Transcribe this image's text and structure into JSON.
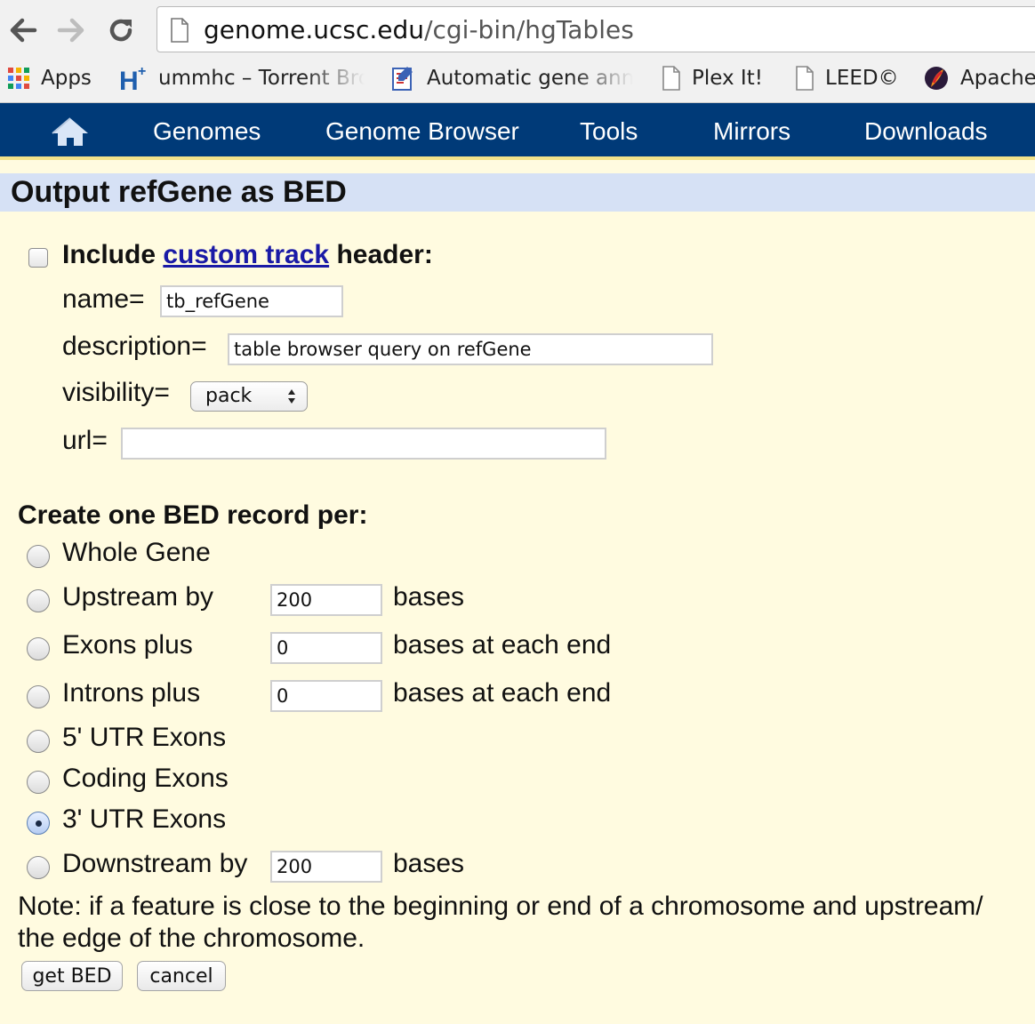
{
  "browser": {
    "url_host": "genome.ucsc.edu",
    "url_path": "/cgi-bin/hgTables",
    "bookmarks": [
      {
        "label": "Apps",
        "icon": "apps-grid-icon"
      },
      {
        "label": "ummhc – Torrent Bro",
        "icon": "h-plus-icon"
      },
      {
        "label": "Automatic gene anno",
        "icon": "document-edit-icon"
      },
      {
        "label": "Plex It!",
        "icon": "page-icon"
      },
      {
        "label": "LEED©",
        "icon": "page-icon"
      },
      {
        "label": "Apache",
        "icon": "apache-feather-icon"
      }
    ]
  },
  "sitenav": {
    "home_icon": "home-icon",
    "items": [
      "Genomes",
      "Genome Browser",
      "Tools",
      "Mirrors",
      "Downloads"
    ],
    "color": "#003a78"
  },
  "page": {
    "title": "Output refGene as BED"
  },
  "header_section": {
    "include_prefix": "Include",
    "include_link": "custom track",
    "include_suffix": "header:",
    "include_checked": false,
    "name_label": "name=",
    "name_value": "tb_refGene",
    "description_label": "description=",
    "description_value": "table browser query on refGene",
    "visibility_label": "visibility=",
    "visibility_value": "pack",
    "url_label": "url=",
    "url_value": ""
  },
  "bed_section": {
    "heading": "Create one BED record per:",
    "options": [
      {
        "label": "Whole Gene",
        "checked": false
      },
      {
        "label": "Upstream by",
        "checked": false,
        "input": "200",
        "suffix": "bases"
      },
      {
        "label": "Exons plus",
        "checked": false,
        "input": "0",
        "suffix": "bases at each end"
      },
      {
        "label": "Introns plus",
        "checked": false,
        "input": "0",
        "suffix": "bases at each end"
      },
      {
        "label": "5' UTR Exons",
        "checked": false
      },
      {
        "label": "Coding Exons",
        "checked": false
      },
      {
        "label": "3' UTR Exons",
        "checked": true
      },
      {
        "label": "Downstream by",
        "checked": false,
        "input": "200",
        "suffix": "bases"
      }
    ],
    "note_line1": "Note: if a feature is close to the beginning or end of a chromosome and upstream/",
    "note_line2": "the edge of the chromosome."
  },
  "buttons": {
    "get_bed": "get BED",
    "cancel": "cancel"
  }
}
